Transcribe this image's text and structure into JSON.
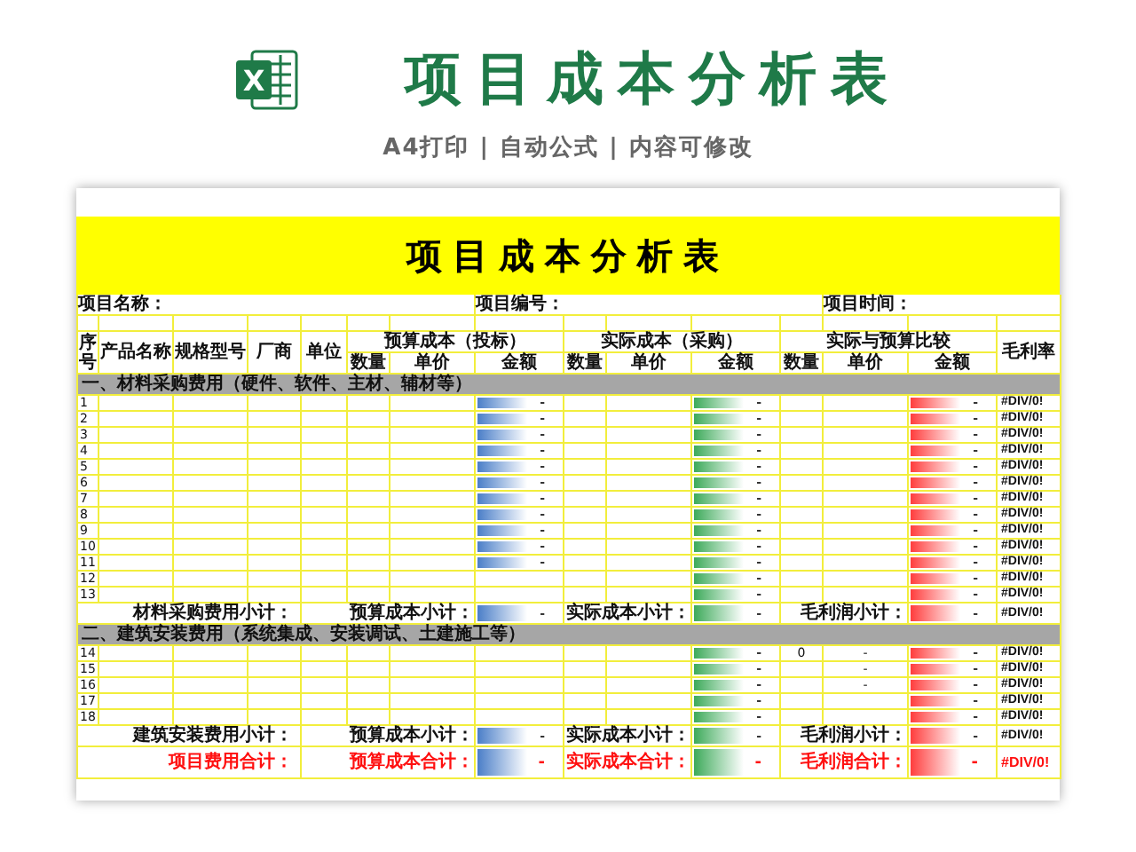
{
  "banner": {
    "logo": "X",
    "title": "项目成本分析表",
    "subtitle": "A4打印 | 自动公式 | 内容可修改"
  },
  "sheet": {
    "title": "项目成本分析表",
    "info": [
      "项目名称：",
      "项目编号：",
      "项目时间："
    ],
    "fixed_columns": [
      "序号",
      "产品名称",
      "规格型号",
      "厂商",
      "单位"
    ],
    "groups": [
      {
        "title": "预算成本（投标）",
        "columns": [
          "数量",
          "单价",
          "金额"
        ]
      },
      {
        "title": "实际成本（采购）",
        "columns": [
          "数量",
          "单价",
          "金额"
        ]
      },
      {
        "title": "实际与预算比较",
        "columns": [
          "数量",
          "单价",
          "金额"
        ]
      }
    ],
    "last_column": "毛利率",
    "sections": [
      {
        "title": "一、材料采购费用（硬件、软件、主材、辅材等）",
        "rows": [
          {
            "no": "1",
            "budget_amount": "-",
            "actual_amount": "-",
            "diff_amount": "-",
            "margin": "#DIV/0!"
          },
          {
            "no": "2",
            "budget_amount": "-",
            "actual_amount": "-",
            "diff_amount": "-",
            "margin": "#DIV/0!"
          },
          {
            "no": "3",
            "budget_amount": "-",
            "actual_amount": "-",
            "diff_amount": "-",
            "margin": "#DIV/0!"
          },
          {
            "no": "4",
            "budget_amount": "-",
            "actual_amount": "-",
            "diff_amount": "-",
            "margin": "#DIV/0!"
          },
          {
            "no": "5",
            "budget_amount": "-",
            "actual_amount": "-",
            "diff_amount": "-",
            "margin": "#DIV/0!"
          },
          {
            "no": "6",
            "budget_amount": "-",
            "actual_amount": "-",
            "diff_amount": "-",
            "margin": "#DIV/0!"
          },
          {
            "no": "7",
            "budget_amount": "-",
            "actual_amount": "-",
            "diff_amount": "-",
            "margin": "#DIV/0!"
          },
          {
            "no": "8",
            "budget_amount": "-",
            "actual_amount": "-",
            "diff_amount": "-",
            "margin": "#DIV/0!"
          },
          {
            "no": "9",
            "budget_amount": "-",
            "actual_amount": "-",
            "diff_amount": "-",
            "margin": "#DIV/0!"
          },
          {
            "no": "10",
            "budget_amount": "-",
            "actual_amount": "-",
            "diff_amount": "-",
            "margin": "#DIV/0!"
          },
          {
            "no": "11",
            "budget_amount": "-",
            "actual_amount": "-",
            "diff_amount": "-",
            "margin": "#DIV/0!"
          },
          {
            "no": "12",
            "actual_amount": "-",
            "diff_amount": "-",
            "margin": "#DIV/0!"
          },
          {
            "no": "13",
            "actual_amount": "-",
            "diff_amount": "-",
            "margin": "#DIV/0!"
          }
        ],
        "subtotal": {
          "label": "材料采购费用小计：",
          "budget_label": "预算成本小计：",
          "budget_amount": "-",
          "actual_label": "实际成本小计：",
          "actual_amount": "-",
          "profit_label": "毛利润小计：",
          "profit_amount": "-",
          "margin": "#DIV/0!"
        }
      },
      {
        "title": "二、建筑安装费用（系统集成、安装调试、土建施工等）",
        "rows": [
          {
            "no": "14",
            "actual_amount": "-",
            "diff_qty": "0",
            "diff_price": "-",
            "diff_amount": "-",
            "margin": "#DIV/0!"
          },
          {
            "no": "15",
            "actual_amount": "-",
            "diff_price": "-",
            "diff_amount": "-",
            "margin": "#DIV/0!"
          },
          {
            "no": "16",
            "actual_amount": "-",
            "diff_price": "-",
            "diff_amount": "-",
            "margin": "#DIV/0!"
          },
          {
            "no": "17",
            "actual_amount": "-",
            "diff_amount": "-",
            "margin": "#DIV/0!"
          },
          {
            "no": "18",
            "actual_amount": "-",
            "diff_amount": "-",
            "margin": "#DIV/0!"
          }
        ],
        "subtotal": {
          "label": "建筑安装费用小计：",
          "budget_label": "预算成本小计：",
          "budget_amount": "-",
          "actual_label": "实际成本小计：",
          "actual_amount": "-",
          "profit_label": "毛利润小计：",
          "profit_amount": "-",
          "margin": "#DIV/0!"
        }
      }
    ],
    "total": {
      "label": "项目费用合计：",
      "budget_label": "预算成本合计：",
      "budget_amount": "-",
      "actual_label": "实际成本合计：",
      "actual_amount": "-",
      "profit_label": "毛利润合计：",
      "profit_amount": "-",
      "margin": "#DIV/0!"
    }
  }
}
